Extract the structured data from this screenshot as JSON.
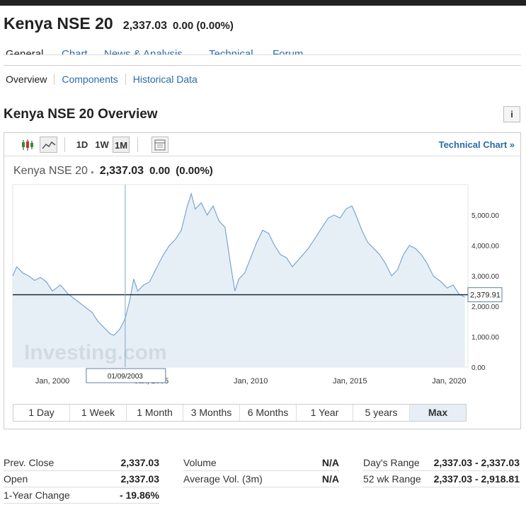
{
  "header": {
    "title": "Kenya NSE 20",
    "price": "2,337.03",
    "change": "0.00 (0.00%)"
  },
  "main_tabs": [
    {
      "label": "General",
      "selected": true
    },
    {
      "label": "Chart"
    },
    {
      "label": "News & Analysis"
    },
    {
      "label": "Technical"
    },
    {
      "label": "Forum"
    }
  ],
  "sub_tabs": [
    {
      "label": "Overview"
    },
    {
      "label": "Components"
    },
    {
      "label": "Historical Data"
    }
  ],
  "overview_title": "Kenya NSE 20 Overview",
  "info_icon": "i",
  "toolbar": {
    "periods": [
      "1D",
      "1W",
      "1M"
    ],
    "selected_period": "1M",
    "technical_chart": "Technical Chart »"
  },
  "chart_header": {
    "name": "Kenya NSE 20",
    "price": "2,337.03",
    "change": "0.00",
    "change_pct": "(0.00%)"
  },
  "chart_data": {
    "type": "area",
    "x_ticks": [
      "Jan, 2000",
      "Jan, 2005",
      "Jan, 2010",
      "Jan, 2015",
      "Jan, 2020"
    ],
    "y_ticks": [
      "0.00",
      "1,000.00",
      "2,000.00",
      "3,000.00",
      "4,000.00",
      "5,000.00"
    ],
    "ylim": [
      0,
      6000
    ],
    "xlim": [
      1998,
      2020.95
    ],
    "current_value_label": "2,379.91",
    "current_value": 2379.91,
    "crosshair_date": "01/09/2003",
    "crosshair_x": 2003.67,
    "watermark": "Investing.com",
    "points": [
      [
        1998.0,
        3000
      ],
      [
        1998.2,
        3300
      ],
      [
        1998.5,
        3100
      ],
      [
        1998.8,
        3000
      ],
      [
        1999.1,
        2850
      ],
      [
        1999.4,
        2950
      ],
      [
        1999.7,
        2800
      ],
      [
        2000.0,
        2500
      ],
      [
        2000.4,
        2700
      ],
      [
        2000.8,
        2400
      ],
      [
        2001.2,
        2200
      ],
      [
        2001.6,
        2000
      ],
      [
        2002.0,
        1800
      ],
      [
        2002.3,
        1500
      ],
      [
        2002.6,
        1300
      ],
      [
        2002.9,
        1100
      ],
      [
        2003.1,
        1050
      ],
      [
        2003.4,
        1250
      ],
      [
        2003.67,
        1600
      ],
      [
        2003.9,
        2200
      ],
      [
        2004.1,
        2900
      ],
      [
        2004.3,
        2500
      ],
      [
        2004.6,
        2700
      ],
      [
        2004.9,
        2800
      ],
      [
        2005.2,
        3200
      ],
      [
        2005.6,
        3700
      ],
      [
        2005.9,
        4000
      ],
      [
        2006.2,
        4200
      ],
      [
        2006.5,
        4500
      ],
      [
        2006.8,
        5300
      ],
      [
        2007.0,
        5700
      ],
      [
        2007.2,
        5200
      ],
      [
        2007.5,
        5400
      ],
      [
        2007.8,
        5000
      ],
      [
        2008.1,
        5300
      ],
      [
        2008.4,
        4800
      ],
      [
        2008.7,
        4600
      ],
      [
        2009.0,
        3300
      ],
      [
        2009.2,
        2500
      ],
      [
        2009.4,
        2900
      ],
      [
        2009.7,
        3100
      ],
      [
        2010.0,
        3600
      ],
      [
        2010.3,
        4100
      ],
      [
        2010.6,
        4500
      ],
      [
        2010.9,
        4400
      ],
      [
        2011.2,
        4000
      ],
      [
        2011.5,
        3700
      ],
      [
        2011.8,
        3600
      ],
      [
        2012.1,
        3300
      ],
      [
        2012.5,
        3600
      ],
      [
        2012.9,
        3900
      ],
      [
        2013.2,
        4200
      ],
      [
        2013.6,
        4600
      ],
      [
        2013.9,
        4900
      ],
      [
        2014.2,
        5000
      ],
      [
        2014.5,
        4900
      ],
      [
        2014.8,
        5200
      ],
      [
        2015.1,
        5300
      ],
      [
        2015.3,
        5000
      ],
      [
        2015.6,
        4500
      ],
      [
        2015.9,
        4100
      ],
      [
        2016.2,
        3900
      ],
      [
        2016.5,
        3700
      ],
      [
        2016.8,
        3400
      ],
      [
        2017.1,
        3000
      ],
      [
        2017.4,
        3200
      ],
      [
        2017.7,
        3700
      ],
      [
        2018.0,
        4000
      ],
      [
        2018.3,
        3900
      ],
      [
        2018.6,
        3700
      ],
      [
        2018.9,
        3400
      ],
      [
        2019.2,
        3000
      ],
      [
        2019.6,
        2800
      ],
      [
        2019.9,
        2600
      ],
      [
        2020.2,
        2700
      ],
      [
        2020.5,
        2400
      ],
      [
        2020.8,
        2300
      ]
    ]
  },
  "range_buttons": [
    "1 Day",
    "1 Week",
    "1 Month",
    "3 Months",
    "6 Months",
    "1 Year",
    "5 years",
    "Max"
  ],
  "range_selected": "Max",
  "stats": {
    "col1": [
      {
        "label": "Prev. Close",
        "value": "2,337.03"
      },
      {
        "label": "Open",
        "value": "2,337.03"
      },
      {
        "label": "1-Year Change",
        "value": "- 19.86%"
      }
    ],
    "col2": [
      {
        "label": "Volume",
        "value": "N/A"
      },
      {
        "label": "Average Vol. (3m)",
        "value": "N/A"
      }
    ],
    "col3": [
      {
        "label": "Day's Range",
        "value": "2,337.03 - 2,337.03"
      },
      {
        "label": "52 wk Range",
        "value": "2,337.03 - 2,918.81"
      }
    ]
  }
}
